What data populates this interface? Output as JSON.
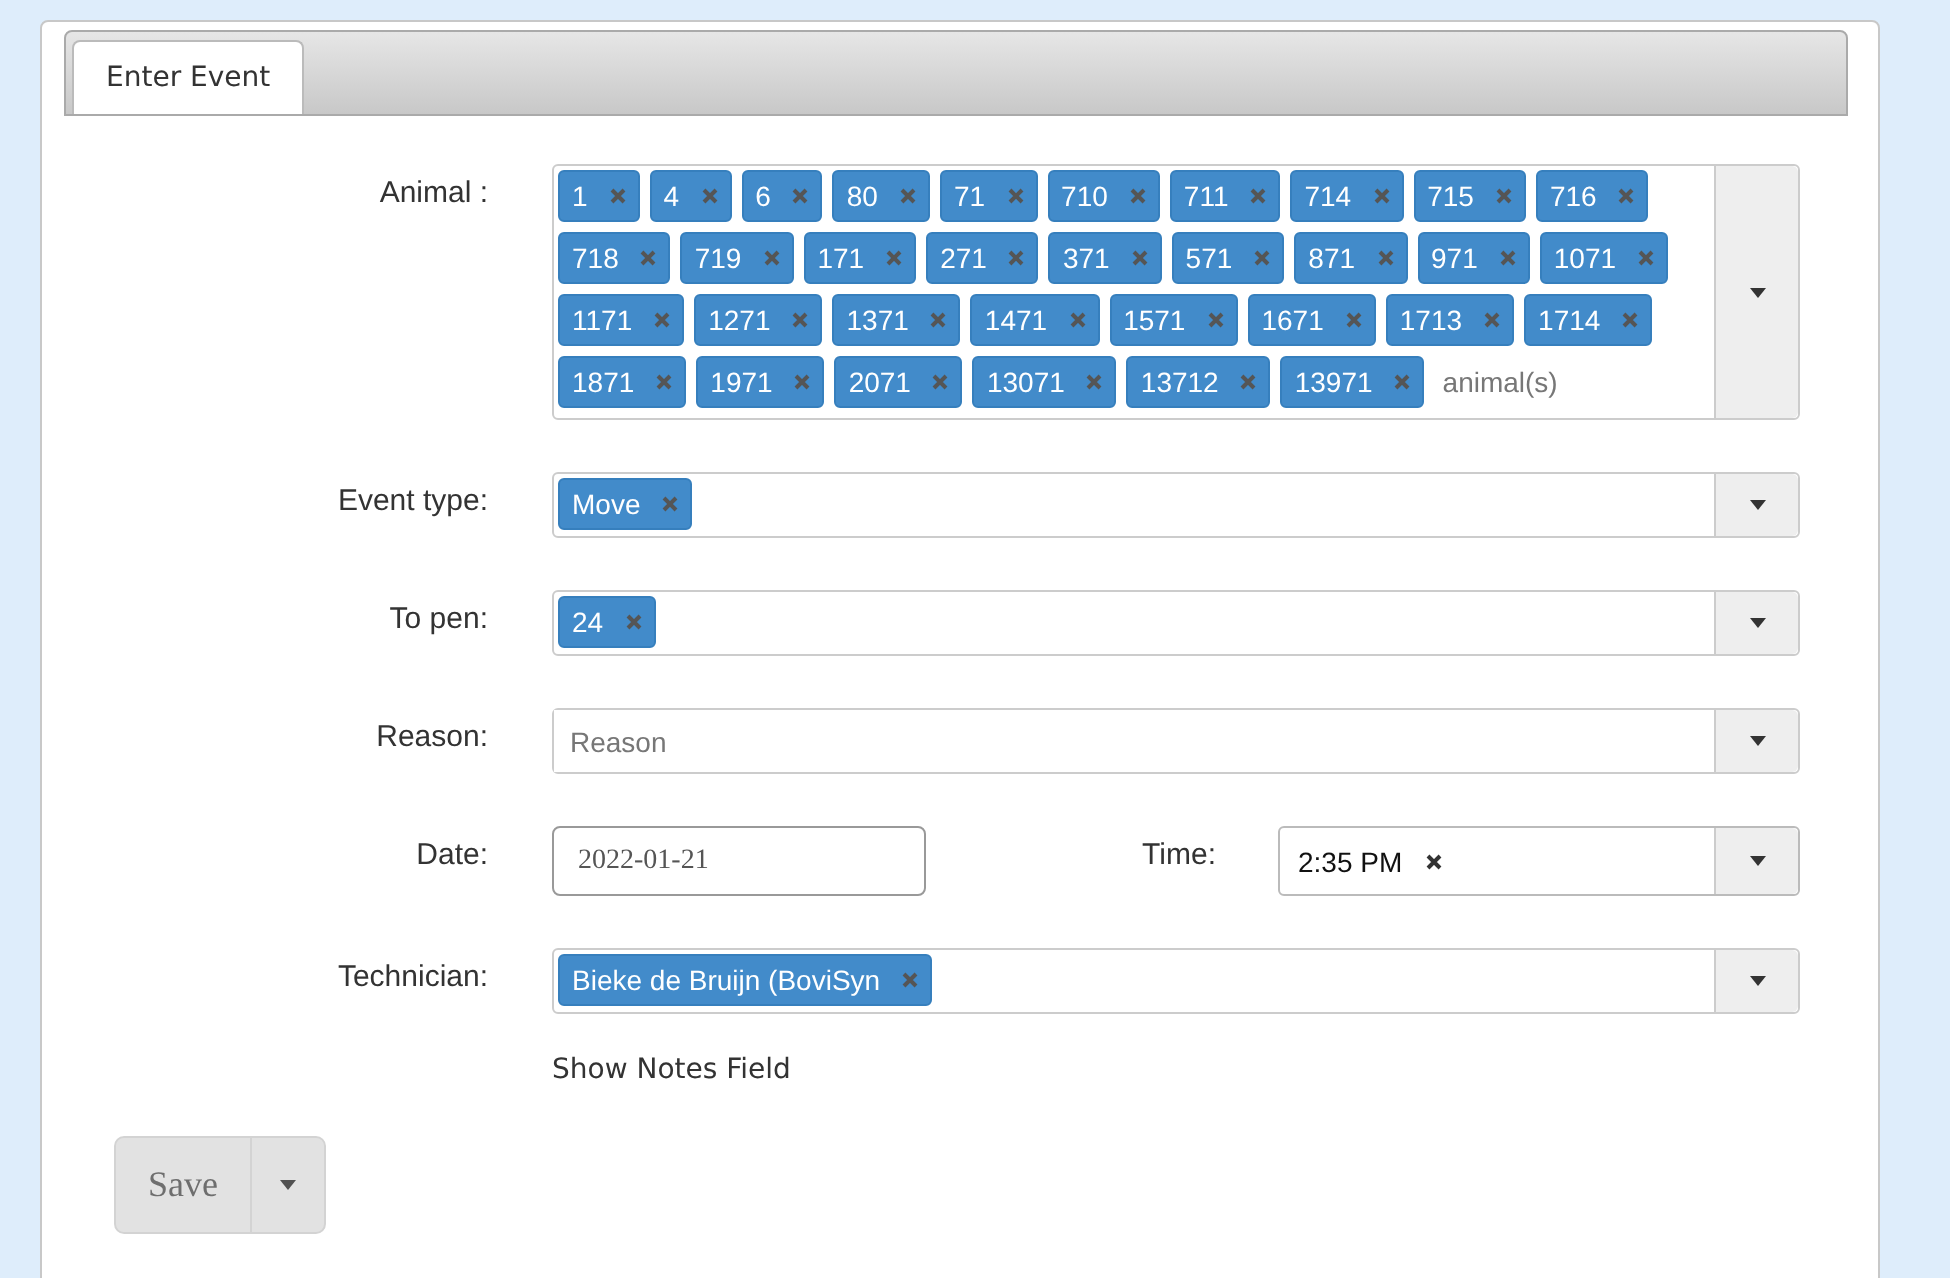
{
  "tabs": [
    {
      "label": "Enter Event",
      "selected": true
    }
  ],
  "animal": {
    "label": "Animal :",
    "tags": [
      "1",
      "4",
      "6",
      "80",
      "71",
      "710",
      "711",
      "714",
      "715",
      "716",
      "718",
      "719",
      "171",
      "271",
      "371",
      "571",
      "871",
      "971",
      "1071",
      "1171",
      "1271",
      "1371",
      "1471",
      "1571",
      "1671",
      "1713",
      "1714",
      "1871",
      "1971",
      "2071",
      "13071",
      "13712",
      "13971"
    ],
    "placeholder": "animal(s)"
  },
  "event_type": {
    "label": "Event type:",
    "tags": [
      "Move"
    ]
  },
  "to_pen": {
    "label": "To pen:",
    "tags": [
      "24"
    ]
  },
  "reason": {
    "label": "Reason:",
    "placeholder": "Reason"
  },
  "date": {
    "label": "Date:",
    "value": "2022-01-21"
  },
  "time": {
    "label": "Time:",
    "value": "2:35 PM"
  },
  "technician": {
    "label": "Technician:",
    "tags": [
      "Bieke de Bruijn (BoviSyn"
    ]
  },
  "notes_link": "Show Notes Field",
  "save": {
    "label": "Save",
    "disabled": true
  }
}
